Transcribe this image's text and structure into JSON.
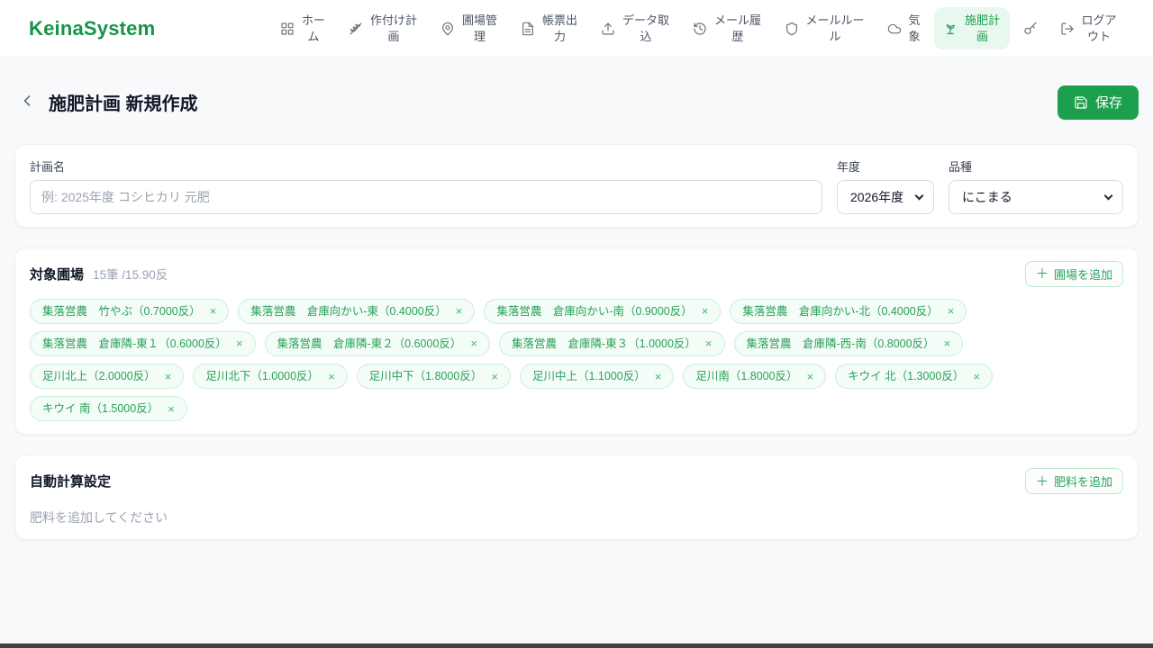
{
  "brand": "KeinaSystem",
  "colors": {
    "brand_green": "#16944a",
    "save_button_green": "#1ca04e",
    "nav_active_bg": "#e9f8ef",
    "nav_active_text": "#1d9b4e",
    "chip_background": "#f3fcf6",
    "chip_border": "#cbeeda",
    "chip_text": "#2aa05c",
    "page_background": "#f8f9fb"
  },
  "icons": {
    "plus": "＋",
    "close": "×"
  },
  "nav": {
    "items": [
      {
        "label": "ホーム",
        "icon": "grid-icon",
        "active": false
      },
      {
        "label": "作付け計画",
        "icon": "wheat-icon",
        "active": false
      },
      {
        "label": "圃場管理",
        "icon": "map-pin-icon",
        "active": false
      },
      {
        "label": "帳票出力",
        "icon": "file-text-icon",
        "active": false
      },
      {
        "label": "データ取込",
        "icon": "upload-icon",
        "active": false
      },
      {
        "label": "メール履歴",
        "icon": "history-icon",
        "active": false
      },
      {
        "label": "メールルール",
        "icon": "shield-icon",
        "active": false
      },
      {
        "label": "気象",
        "icon": "cloud-icon",
        "active": false
      },
      {
        "label": "施肥計画",
        "icon": "sprout-icon",
        "active": true
      },
      {
        "label": "",
        "icon": "key-icon",
        "active": false
      },
      {
        "label": "ログアウト",
        "icon": "logout-icon",
        "active": false
      }
    ]
  },
  "header": {
    "title": "施肥計画 新規作成",
    "save_label": "保存"
  },
  "form": {
    "plan_name": {
      "label": "計画名",
      "placeholder": "例: 2025年度 コシヒカリ 元肥",
      "value": ""
    },
    "year": {
      "label": "年度",
      "value": "2026年度"
    },
    "variety": {
      "label": "品種",
      "value": "にこまる"
    }
  },
  "fields_section": {
    "title": "対象圃場",
    "count_summary": "15筆 /15.90反",
    "add_button_label": "圃場を追加",
    "chips": [
      "集落営農　竹やぶ（0.7000反）",
      "集落営農　倉庫向かい-東（0.4000反）",
      "集落営農　倉庫向かい-南（0.9000反）",
      "集落営農　倉庫向かい-北（0.4000反）",
      "集落営農　倉庫隣-東１（0.6000反）",
      "集落営農　倉庫隣-東２（0.6000反）",
      "集落営農　倉庫隣-東３（1.0000反）",
      "集落営農　倉庫隣-西-南（0.8000反）",
      "足川北上（2.0000反）",
      "足川北下（1.0000反）",
      "足川中下（1.8000反）",
      "足川中上（1.1000反）",
      "足川南（1.8000反）",
      "キウイ 北（1.3000反）",
      "キウイ 南（1.5000反）"
    ]
  },
  "fertilizer_section": {
    "title": "自動計算設定",
    "add_button_label": "肥料を追加",
    "empty_message": "肥料を追加してください"
  }
}
